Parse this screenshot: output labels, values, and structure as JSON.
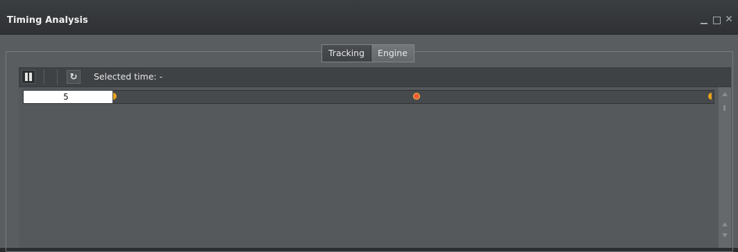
{
  "window": {
    "title": "Timing Analysis",
    "controls": [
      "minimize-icon",
      "maximize-icon",
      "close-icon"
    ],
    "close_glyph": "✕"
  },
  "tabs": [
    {
      "label": "Tracking",
      "active": true
    },
    {
      "label": "Engine",
      "active": false
    }
  ],
  "toolbar": {
    "pause_icon": "pause-icon",
    "refresh_icon": "refresh-icon",
    "refresh_glyph": "↻",
    "selected_time_text": "Selected time: -"
  },
  "track": {
    "value": "5",
    "markers": [
      "start-marker-icon",
      "center-marker-icon",
      "end-marker-icon"
    ]
  },
  "colors": {
    "accent_orange": "#e8a21a",
    "marker_red": "#f05a3a"
  }
}
